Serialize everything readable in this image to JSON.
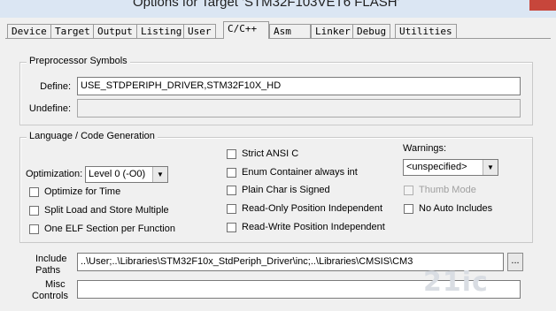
{
  "window": {
    "title": "Options for Target 'STM32F103VET6 FLASH'"
  },
  "tabs": [
    {
      "label": "Device"
    },
    {
      "label": "Target"
    },
    {
      "label": "Output"
    },
    {
      "label": "Listing"
    },
    {
      "label": "User"
    },
    {
      "label": "C/C++"
    },
    {
      "label": "Asm"
    },
    {
      "label": "Linker"
    },
    {
      "label": "Debug"
    },
    {
      "label": "Utilities"
    }
  ],
  "preprocessor": {
    "title": "Preprocessor Symbols",
    "define_label": "Define:",
    "define_value": "USE_STDPERIPH_DRIVER,STM32F10X_HD",
    "undefine_label": "Undefine:",
    "undefine_value": ""
  },
  "language": {
    "title": "Language / Code Generation",
    "optimization_label": "Optimization:",
    "optimization_value": "Level 0 (-O0)",
    "optimize_for_time": "Optimize for Time",
    "split_load_store": "Split Load and Store Multiple",
    "one_elf_section": "One ELF Section per Function",
    "strict_ansi": "Strict ANSI C",
    "enum_container": "Enum Container always int",
    "plain_char_signed": "Plain Char is Signed",
    "ro_position_independent": "Read-Only Position Independent",
    "rw_position_independent": "Read-Write Position Independent",
    "warnings_label": "Warnings:",
    "warnings_value": "<unspecified>",
    "thumb_mode": "Thumb Mode",
    "no_auto_includes": "No Auto Includes"
  },
  "paths": {
    "include_label_1": "Include",
    "include_label_2": "Paths",
    "include_value": "..\\User;..\\Libraries\\STM32F10x_StdPeriph_Driver\\inc;..\\Libraries\\CMSIS\\CM3",
    "browse_label": "...",
    "misc_label_1": "Misc",
    "misc_label_2": "Controls",
    "misc_value": ""
  },
  "watermark": "21ic"
}
